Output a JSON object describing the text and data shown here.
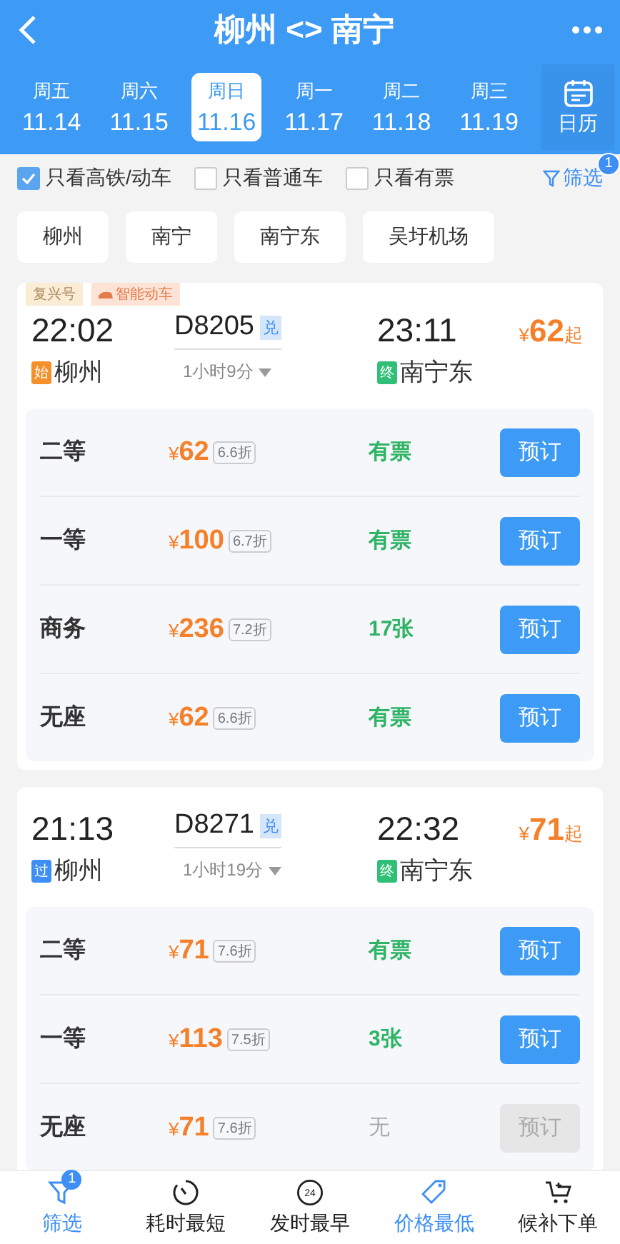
{
  "header": {
    "title": "柳州 <> 南宁"
  },
  "dates": [
    {
      "weekday": "周五",
      "date": "11.14",
      "selected": false
    },
    {
      "weekday": "周六",
      "date": "11.15",
      "selected": false
    },
    {
      "weekday": "周日",
      "date": "11.16",
      "selected": true
    },
    {
      "weekday": "周一",
      "date": "11.17",
      "selected": false
    },
    {
      "weekday": "周二",
      "date": "11.18",
      "selected": false
    },
    {
      "weekday": "周三",
      "date": "11.19",
      "selected": false
    }
  ],
  "calendar_button": "日历",
  "filters": [
    {
      "label": "只看高铁/动车",
      "checked": true
    },
    {
      "label": "只看普通车",
      "checked": false
    },
    {
      "label": "只看有票",
      "checked": false
    }
  ],
  "filter_button": {
    "label": "筛选",
    "badge": "1"
  },
  "stations": [
    "柳州",
    "南宁",
    "南宁东",
    "吴圩机场"
  ],
  "trains": [
    {
      "tags": [
        {
          "label": "复兴号",
          "kind": "plain"
        },
        {
          "label": "智能动车",
          "kind": "smart"
        }
      ],
      "depart": "22:02",
      "number": "D8205",
      "number_badge": "兑",
      "arrive": "23:11",
      "price_from": "62",
      "currency": "¥",
      "from_suffix": "起",
      "origin_badge": {
        "label": "始",
        "kind": "origin"
      },
      "origin": "柳州",
      "duration": "1小时9分",
      "dest_badge": {
        "label": "终",
        "kind": "terminal"
      },
      "destination": "南宁东",
      "seats": [
        {
          "class": "二等",
          "price": "62",
          "discount": "6.6折",
          "status": "有票",
          "available": true,
          "button": "预订"
        },
        {
          "class": "一等",
          "price": "100",
          "discount": "6.7折",
          "status": "有票",
          "available": true,
          "button": "预订"
        },
        {
          "class": "商务",
          "price": "236",
          "discount": "7.2折",
          "status": "17张",
          "available": true,
          "button": "预订"
        },
        {
          "class": "无座",
          "price": "62",
          "discount": "6.6折",
          "status": "有票",
          "available": true,
          "button": "预订"
        }
      ]
    },
    {
      "depart": "21:13",
      "number": "D8271",
      "number_badge": "兑",
      "arrive": "22:32",
      "price_from": "71",
      "currency": "¥",
      "from_suffix": "起",
      "origin_badge": {
        "label": "过",
        "kind": "pass"
      },
      "origin": "柳州",
      "duration": "1小时19分",
      "dest_badge": {
        "label": "终",
        "kind": "terminal"
      },
      "destination": "南宁东",
      "seats": [
        {
          "class": "二等",
          "price": "71",
          "discount": "7.6折",
          "status": "有票",
          "available": true,
          "button": "预订"
        },
        {
          "class": "一等",
          "price": "113",
          "discount": "7.5折",
          "status": "3张",
          "available": true,
          "button": "预订"
        },
        {
          "class": "无座",
          "price": "71",
          "discount": "7.6折",
          "status": "无",
          "available": false,
          "button": "预订"
        }
      ]
    }
  ],
  "bottom_nav": [
    {
      "label": "筛选",
      "selected": true,
      "badge": "1"
    },
    {
      "label": "耗时最短",
      "selected": false
    },
    {
      "label": "发时最早",
      "selected": false,
      "icon_text": "24"
    },
    {
      "label": "价格最低",
      "selected": true
    },
    {
      "label": "候补下单",
      "selected": false
    }
  ]
}
